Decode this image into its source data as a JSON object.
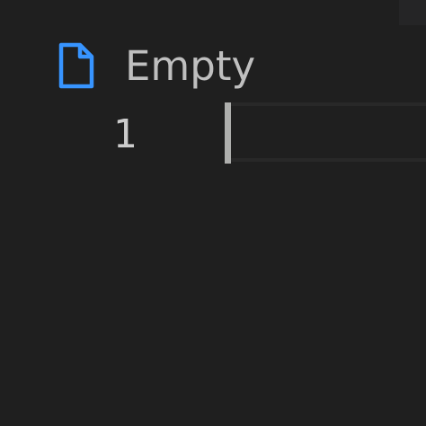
{
  "breadcrumb": {
    "file_icon": "file-icon",
    "file_name": "Empty"
  },
  "editor": {
    "line_numbers": [
      "1"
    ],
    "content": ""
  },
  "colors": {
    "background": "#1f1f1f",
    "file_icon": "#3794ff",
    "file_name_text": "#bfbfbf",
    "line_number_text": "#cccccc",
    "cursor": "#aeafad"
  }
}
